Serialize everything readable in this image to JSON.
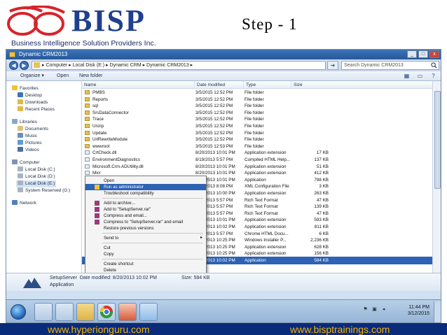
{
  "slide": {
    "logo_text": "BISP",
    "logo_subtitle": "Business Intelligence Solution Providers Inc.",
    "step_title": "Step - 1",
    "footer_left": "www.hyperionguru.com",
    "footer_right": "www.bisptrainings.com",
    "brand_colors": {
      "navy": "#1f3f8f",
      "red": "#d8232a",
      "footer_bg": "#0a2a7a",
      "footer_text": "#f5b400"
    }
  },
  "window": {
    "title": "Dynamic CRM2013",
    "controls": [
      "_",
      "□",
      "x"
    ]
  },
  "address_bar": {
    "path": "▸ Computer ▸ Local Disk (E:) ▸ Dynamic CRM ▸ Dynamic CRM2013 ▸",
    "search_placeholder": "Search Dynamic CRM2013"
  },
  "toolbar": {
    "organize": "Organize ▾",
    "open": "Open",
    "new_folder": "New folder"
  },
  "nav_pane": {
    "favorites_label": "Favorites",
    "favorites": [
      "Desktop",
      "Downloads",
      "Recent Places"
    ],
    "libraries_label": "Libraries",
    "libraries": [
      "Documents",
      "Music",
      "Pictures",
      "Videos"
    ],
    "computer_label": "Computer",
    "drives": [
      "Local Disk (C:)",
      "Local Disk (D:)",
      "Local Disk (E:)",
      "System Reserved (G:)"
    ],
    "network_label": "Network"
  },
  "columns": [
    "Name",
    "Date modified",
    "Type",
    "Size"
  ],
  "files": [
    {
      "name": "PMBS",
      "date": "3/5/2015 12:52 PM",
      "type": "File folder",
      "size": "",
      "kind": "folder"
    },
    {
      "name": "Reports",
      "date": "3/5/2015 12:52 PM",
      "type": "File folder",
      "size": "",
      "kind": "folder"
    },
    {
      "name": "sql",
      "date": "3/5/2015 12:52 PM",
      "type": "File folder",
      "size": "",
      "kind": "folder"
    },
    {
      "name": "SrsDataConnector",
      "date": "3/5/2015 12:52 PM",
      "type": "File folder",
      "size": "",
      "kind": "folder"
    },
    {
      "name": "Trace",
      "date": "3/5/2015 12:52 PM",
      "type": "File folder",
      "size": "",
      "kind": "folder"
    },
    {
      "name": "Unzip",
      "date": "3/5/2015 12:52 PM",
      "type": "File folder",
      "size": "",
      "kind": "folder"
    },
    {
      "name": "Update",
      "date": "3/5/2015 12:52 PM",
      "type": "File folder",
      "size": "",
      "kind": "folder"
    },
    {
      "name": "UrlRewriteModule",
      "date": "3/5/2015 12:52 PM",
      "type": "File folder",
      "size": "",
      "kind": "folder"
    },
    {
      "name": "wwwroot",
      "date": "3/5/2015 12:53 PM",
      "type": "File folder",
      "size": "",
      "kind": "folder"
    },
    {
      "name": "CrtCheck.dll",
      "date": "8/20/2013 10:01 PM",
      "type": "Application extension",
      "size": "17 KB",
      "kind": "dll"
    },
    {
      "name": "EnvironmentDiagnostics",
      "date": "8/19/2013 5:57 PM",
      "type": "Compiled HTML Help...",
      "size": "137 KB",
      "kind": "dll"
    },
    {
      "name": "Microsoft.Crm.ADUtility.dll",
      "date": "8/20/2013 10:01 PM",
      "type": "Application extension",
      "size": "51 KB",
      "kind": "dll"
    },
    {
      "name": "Micr",
      "date": "8/20/2013 10:01 PM",
      "type": "Application extension",
      "size": "412 KB",
      "kind": "dll"
    },
    {
      "name": "Micr",
      "date": "8/20/2013 10:01 PM",
      "type": "Application",
      "size": "798 KB",
      "kind": "exe"
    },
    {
      "name": "Micr",
      "date": "8/20/2013 8:08 PM",
      "type": "XML Configuration File",
      "size": "3 KB",
      "kind": "dll"
    },
    {
      "name": "Micr",
      "date": "8/20/2013 10:00 PM",
      "type": "Application extension",
      "size": "263 KB",
      "kind": "dll"
    },
    {
      "name": "MSCI",
      "date": "8/20/2013 5:57 PM",
      "type": "Rich Text Format",
      "size": "47 KB",
      "kind": "dll"
    },
    {
      "name": "MSCI",
      "date": "8/20/2013 5:57 PM",
      "type": "Rich Text Format",
      "size": "139 KB",
      "kind": "dll"
    },
    {
      "name": "MSCI",
      "date": "8/20/2013 5:57 PM",
      "type": "Rich Text Format",
      "size": "47 KB",
      "kind": "dll"
    },
    {
      "name": "msvc",
      "date": "8/20/2013 10:01 PM",
      "type": "Application extension",
      "size": "593 KB",
      "kind": "dll"
    },
    {
      "name": "msvc",
      "date": "8/20/2013 10:02 PM",
      "type": "Application extension",
      "size": "811 KB",
      "kind": "dll"
    },
    {
      "name": "Read",
      "date": "8/20/2013 5:57 PM",
      "type": "Chrome HTML Docu...",
      "size": "6 KB",
      "kind": "dll"
    },
    {
      "name": "Serv",
      "date": "8/20/2013 10:25 PM",
      "type": "Windows Installer P...",
      "size": "2,236 KB",
      "kind": "dll"
    },
    {
      "name": "Serv",
      "date": "8/20/2013 10:25 PM",
      "type": "Application extension",
      "size": "628 KB",
      "kind": "dll"
    },
    {
      "name": "Setu",
      "date": "8/20/2013 10:25 PM",
      "type": "Application extension",
      "size": "156 KB",
      "kind": "dll"
    },
    {
      "name": "SetupServer",
      "date": "8/20/2013 10:02 PM",
      "type": "Application",
      "size": "584 KB",
      "kind": "exe",
      "selected": true
    }
  ],
  "context_menu": {
    "items": [
      "Open",
      "Run as administrator",
      "Troubleshoot compatibility",
      "Add to archive...",
      "Add to \"SetupServer.rar\"",
      "Compress and email...",
      "Compress to \"SetupServer.rar\" and email",
      "Restore previous versions",
      "Send to",
      "Cut",
      "Copy",
      "Create shortcut",
      "Delete",
      "Rename",
      "Properties"
    ],
    "highlighted": "Run as administrator",
    "submenu_arrow": "▸"
  },
  "details": {
    "name": "SetupServer",
    "date_label": "Date modified: 8/20/2013 10:02 PM",
    "type": "Application",
    "size": "Size: 584 KB"
  },
  "taskbar": {
    "clock_time": "11:44 PM",
    "clock_date": "3/12/2015",
    "tray_icons": [
      "flag-icon",
      "network-icon",
      "volume-icon"
    ]
  }
}
